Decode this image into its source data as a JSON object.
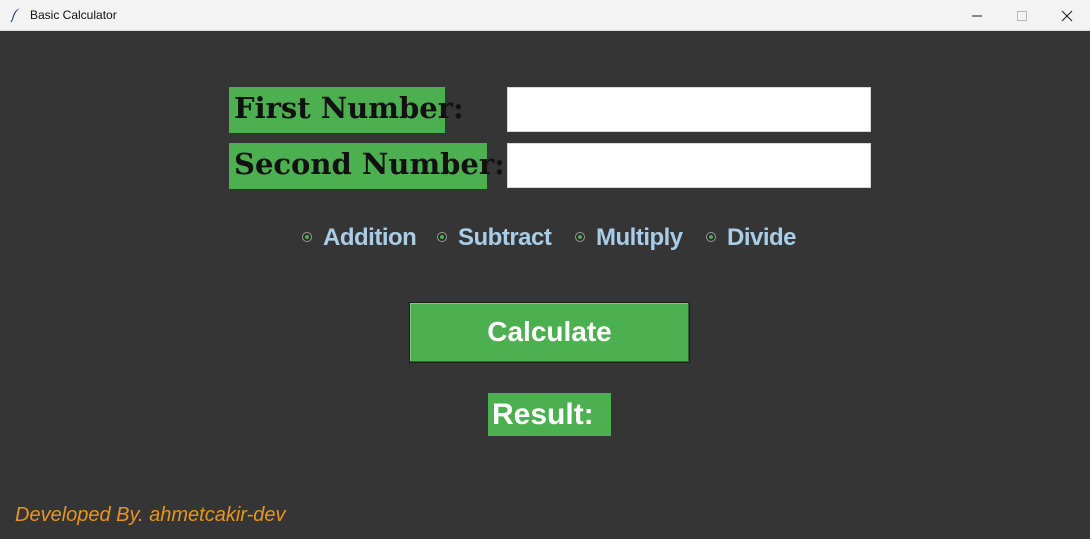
{
  "window": {
    "title": "Basic Calculator",
    "icon": "feather-icon",
    "controls": [
      "minimize-icon",
      "maximize-icon",
      "close-icon"
    ]
  },
  "form": {
    "first_label": "First Number:",
    "first_value": "",
    "second_label": "Second Number:",
    "second_value": ""
  },
  "operations": {
    "selected": null,
    "items": [
      {
        "label": "Addition"
      },
      {
        "label": "Subtract"
      },
      {
        "label": "Multiply"
      },
      {
        "label": "Divide"
      }
    ]
  },
  "calculate_label": "Calculate",
  "result_text": "Result:",
  "footer_text": "Developed By. ahmetcakir-dev",
  "colors": {
    "background": "#353535",
    "accent_green": "#4caf50",
    "radio_text": "#a9cde6",
    "footer_text": "#e8941f"
  }
}
